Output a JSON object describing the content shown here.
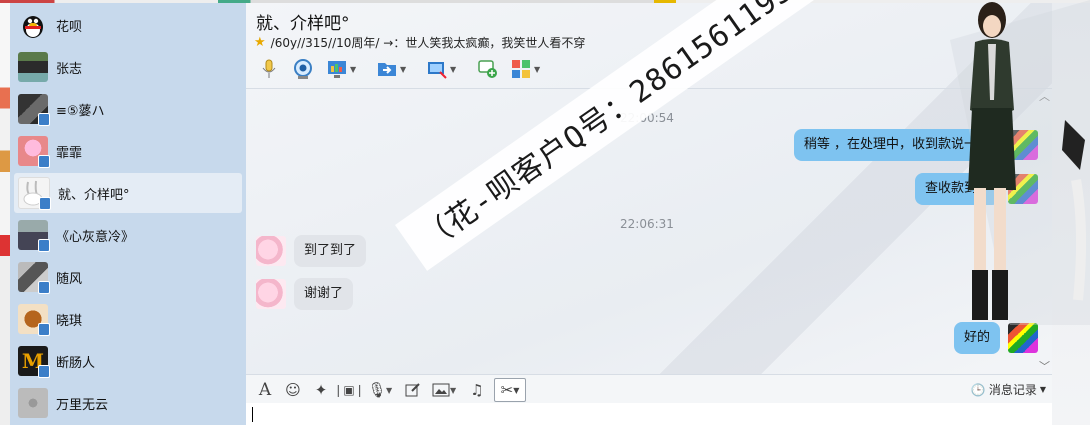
{
  "sidebar": {
    "contacts": [
      {
        "name": "花呗",
        "avatar": "qq-penguin-icon",
        "active": false
      },
      {
        "name": "张志",
        "avatar": "photo-avatar",
        "active": false
      },
      {
        "name": "≡⑤蔢ハ",
        "avatar": "photo-avatar",
        "active": false
      },
      {
        "name": "霏霏",
        "avatar": "pink-avatar",
        "active": false
      },
      {
        "name": "就、介样吧°",
        "avatar": "rabbit-avatar",
        "active": true
      },
      {
        "name": "《心灰意冷》",
        "avatar": "photo-avatar",
        "active": false
      },
      {
        "name": "随风",
        "avatar": "photo-avatar",
        "active": false
      },
      {
        "name": "晓琪",
        "avatar": "photo-avatar",
        "active": false
      },
      {
        "name": "断肠人",
        "avatar": "mcdonalds-avatar",
        "active": false
      },
      {
        "name": "万里无云",
        "avatar": "gray-avatar",
        "active": false
      }
    ]
  },
  "header": {
    "title": "就、介样吧°",
    "signature": "/60y//315//10周年/ →：世人笑我太疯癫，我笑世人看不穿"
  },
  "messages": [
    {
      "type": "time",
      "text": "22:00:54"
    },
    {
      "type": "out",
      "text": "稍等 ，在处理中，收到款说一下"
    },
    {
      "type": "out",
      "text": "查收款到了"
    },
    {
      "type": "time",
      "text": "22:06:31"
    },
    {
      "type": "in",
      "text": "到了到了"
    },
    {
      "type": "in",
      "text": "谢谢了"
    },
    {
      "type": "out",
      "text": "好的"
    }
  ],
  "input": {
    "history_label": "消息记录",
    "value": ""
  },
  "watermark": "（花-呗客户Q号：2861561193）",
  "colors": {
    "sidebar_bg": "#c7d9ec",
    "out_bubble": "#7ec3f0",
    "in_bubble": "#e1e4e9"
  }
}
